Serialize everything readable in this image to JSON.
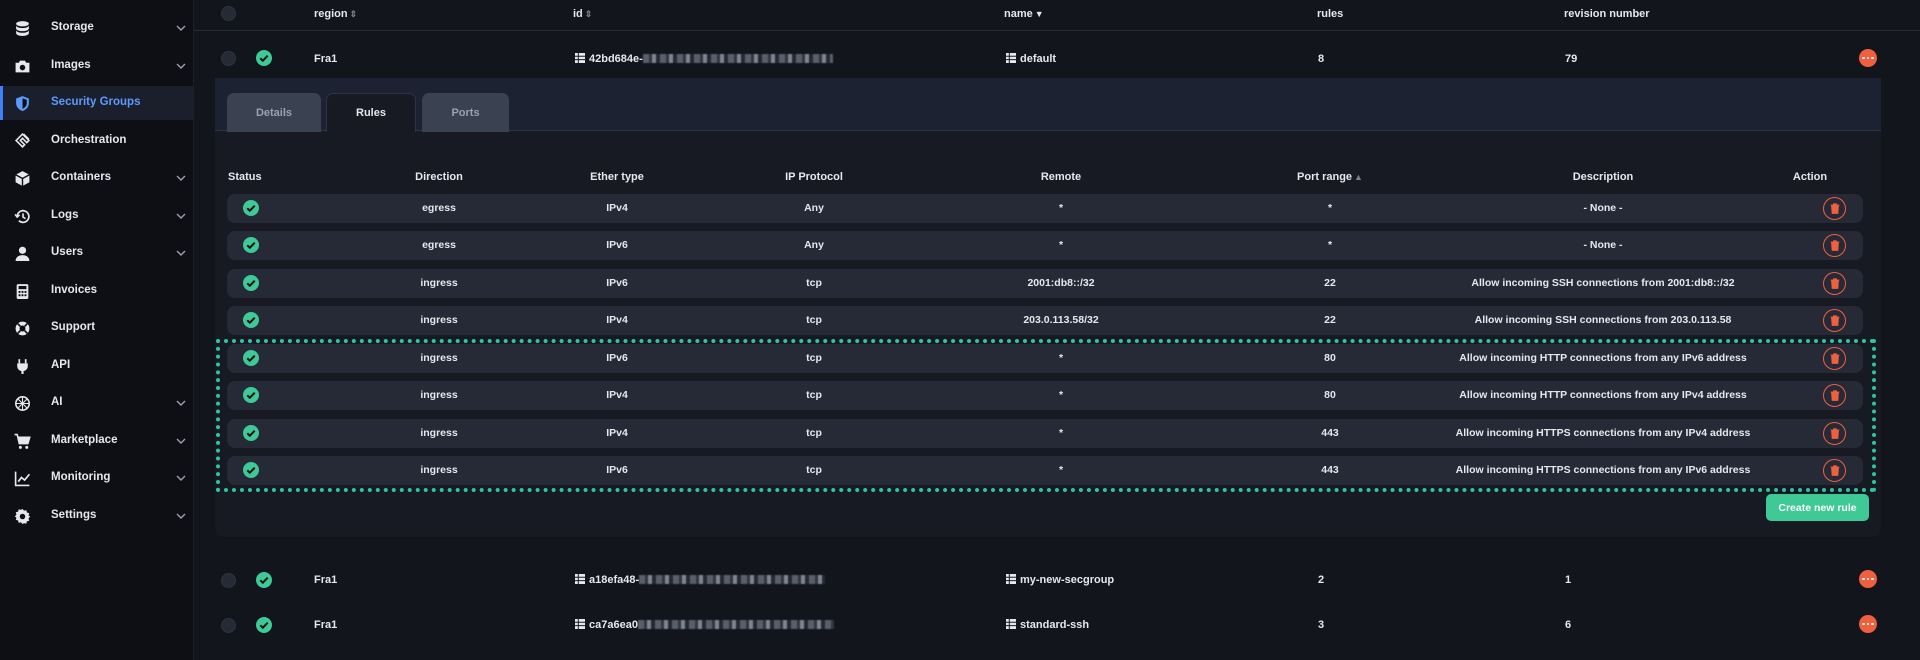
{
  "sidebar": {
    "items": [
      {
        "label": "Storage",
        "icon": "database-icon",
        "chevron": true
      },
      {
        "label": "Images",
        "icon": "camera-icon",
        "chevron": true
      },
      {
        "label": "Security Groups",
        "icon": "shield-icon",
        "chevron": false,
        "active": true
      },
      {
        "label": "Orchestration",
        "icon": "orchestration-icon",
        "chevron": false
      },
      {
        "label": "Containers",
        "icon": "cube-icon",
        "chevron": true
      },
      {
        "label": "Logs",
        "icon": "history-icon",
        "chevron": true
      },
      {
        "label": "Users",
        "icon": "user-icon",
        "chevron": true
      },
      {
        "label": "Invoices",
        "icon": "calculator-icon",
        "chevron": false
      },
      {
        "label": "Support",
        "icon": "lifebuoy-icon",
        "chevron": false
      },
      {
        "label": "API",
        "icon": "plug-icon",
        "chevron": false
      },
      {
        "label": "AI",
        "icon": "ai-icon",
        "chevron": true
      },
      {
        "label": "Marketplace",
        "icon": "cart-icon",
        "chevron": true
      },
      {
        "label": "Monitoring",
        "icon": "chart-icon",
        "chevron": true
      },
      {
        "label": "Settings",
        "icon": "gear-icon",
        "chevron": true
      }
    ]
  },
  "table": {
    "headers": {
      "region": "region",
      "id": "id",
      "name": "name",
      "rules": "rules",
      "revision": "revision number"
    },
    "groups": [
      {
        "region": "Fra1",
        "id_prefix": "42bd684e-",
        "name": "default",
        "rules": "8",
        "revision": "79"
      },
      {
        "region": "Fra1",
        "id_prefix": "a18efa48-",
        "name": "my-new-secgroup",
        "rules": "2",
        "revision": "1"
      },
      {
        "region": "Fra1",
        "id_prefix": "ca7a6ea0",
        "name": "standard-ssh",
        "rules": "3",
        "revision": "6"
      }
    ]
  },
  "panel": {
    "tabs": [
      "Details",
      "Rules",
      "Ports"
    ],
    "active_tab": "Rules",
    "rule_headers": [
      "Status",
      "Direction",
      "Ether type",
      "IP Protocol",
      "Remote",
      "Port range",
      "Description",
      "Action"
    ],
    "rules": [
      {
        "direction": "egress",
        "ether": "IPv4",
        "protocol": "Any",
        "remote": "*",
        "port": "*",
        "description": "- None -"
      },
      {
        "direction": "egress",
        "ether": "IPv6",
        "protocol": "Any",
        "remote": "*",
        "port": "*",
        "description": "- None -"
      },
      {
        "direction": "ingress",
        "ether": "IPv6",
        "protocol": "tcp",
        "remote": "2001:db8::/32",
        "port": "22",
        "description": "Allow incoming SSH connections from 2001:db8::/32"
      },
      {
        "direction": "ingress",
        "ether": "IPv4",
        "protocol": "tcp",
        "remote": "203.0.113.58/32",
        "port": "22",
        "description": "Allow incoming SSH connections from 203.0.113.58"
      },
      {
        "direction": "ingress",
        "ether": "IPv6",
        "protocol": "tcp",
        "remote": "*",
        "port": "80",
        "description": "Allow incoming HTTP connections from any IPv6 address"
      },
      {
        "direction": "ingress",
        "ether": "IPv4",
        "protocol": "tcp",
        "remote": "*",
        "port": "80",
        "description": "Allow incoming HTTP connections from any IPv4 address"
      },
      {
        "direction": "ingress",
        "ether": "IPv4",
        "protocol": "tcp",
        "remote": "*",
        "port": "443",
        "description": "Allow incoming HTTPS connections from any IPv4 address"
      },
      {
        "direction": "ingress",
        "ether": "IPv6",
        "protocol": "tcp",
        "remote": "*",
        "port": "443",
        "description": "Allow incoming HTTPS connections from any IPv6 address"
      }
    ],
    "create_label": "Create new rule"
  },
  "colors": {
    "accent": "#5b9bff",
    "success": "#3ec996",
    "danger": "#f0603e",
    "highlight": "#2ec4a0"
  }
}
